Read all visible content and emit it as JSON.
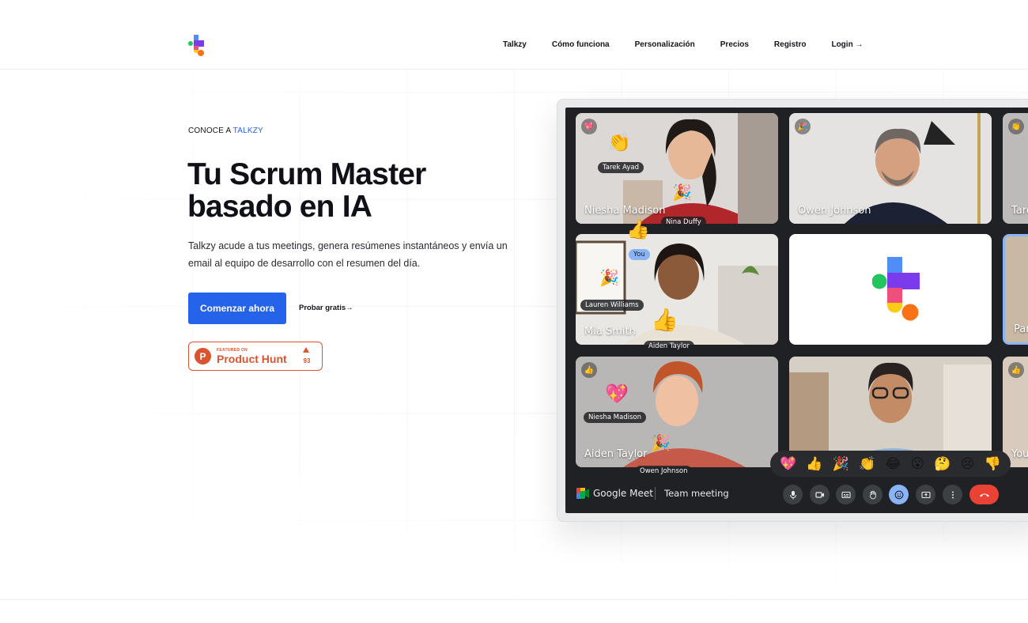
{
  "nav": {
    "items": [
      "Talkzy",
      "Cómo funciona",
      "Personalización",
      "Precios",
      "Registro",
      "Login →"
    ]
  },
  "hero": {
    "eyebrow_prefix": "CONOCE A ",
    "eyebrow_brand": "TALKZY",
    "title_line1": "Tu Scrum Master",
    "title_line2": "basado en IA",
    "description": "Talkzy acude a tus meetings, genera resúmenes instantáneos y envía un email al equipo de desarrollo con el resumen del día.",
    "cta_label": "Comenzar ahora",
    "secondary_label": "Probar gratis→",
    "product_hunt": {
      "featured": "FEATURED ON",
      "name": "Product Hunt",
      "votes": "93"
    }
  },
  "meet": {
    "brand": "Google Meet",
    "meeting_name": "Team meeting",
    "tiles": {
      "t1_name": "Niesha Madison",
      "t2_name": "Owen Johnson",
      "t3_name": "Tare",
      "t4_name": "Mia Smith",
      "t6_name": "Par",
      "t7_name": "Aiden Taylor",
      "t9_name": "You"
    },
    "tags": {
      "tarek": "Tarek Ayad",
      "nina": "Nina Duffy",
      "you": "You",
      "lauren": "Lauren Williams",
      "aiden": "Aiden Taylor",
      "niesha": "Niesha Madison",
      "owen": "Owen Johnson"
    },
    "reactions": [
      "💖",
      "👍",
      "🎉",
      "👏",
      "😂",
      "😮",
      "🤔",
      "😢",
      "👎"
    ]
  },
  "colors": {
    "accent": "#2563eb",
    "product_hunt": "#da552f",
    "meet_bg": "#202124"
  }
}
